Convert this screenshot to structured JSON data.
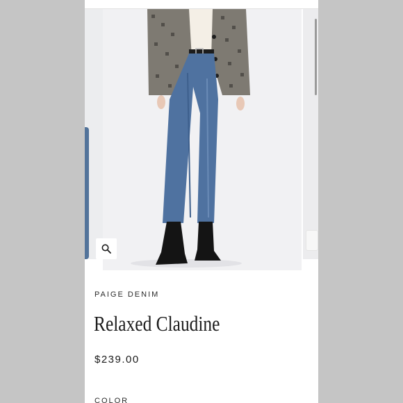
{
  "product": {
    "brand": "PAIGE DENIM",
    "name": "Relaxed Claudine",
    "price": "$239.00",
    "color_label": "COLOR"
  },
  "gallery": {
    "zoom_icon": "magnifier-icon"
  },
  "colors": {
    "denim": "#4f72a0",
    "background": "#ffffff",
    "side_bars": "#c5c5c5"
  }
}
